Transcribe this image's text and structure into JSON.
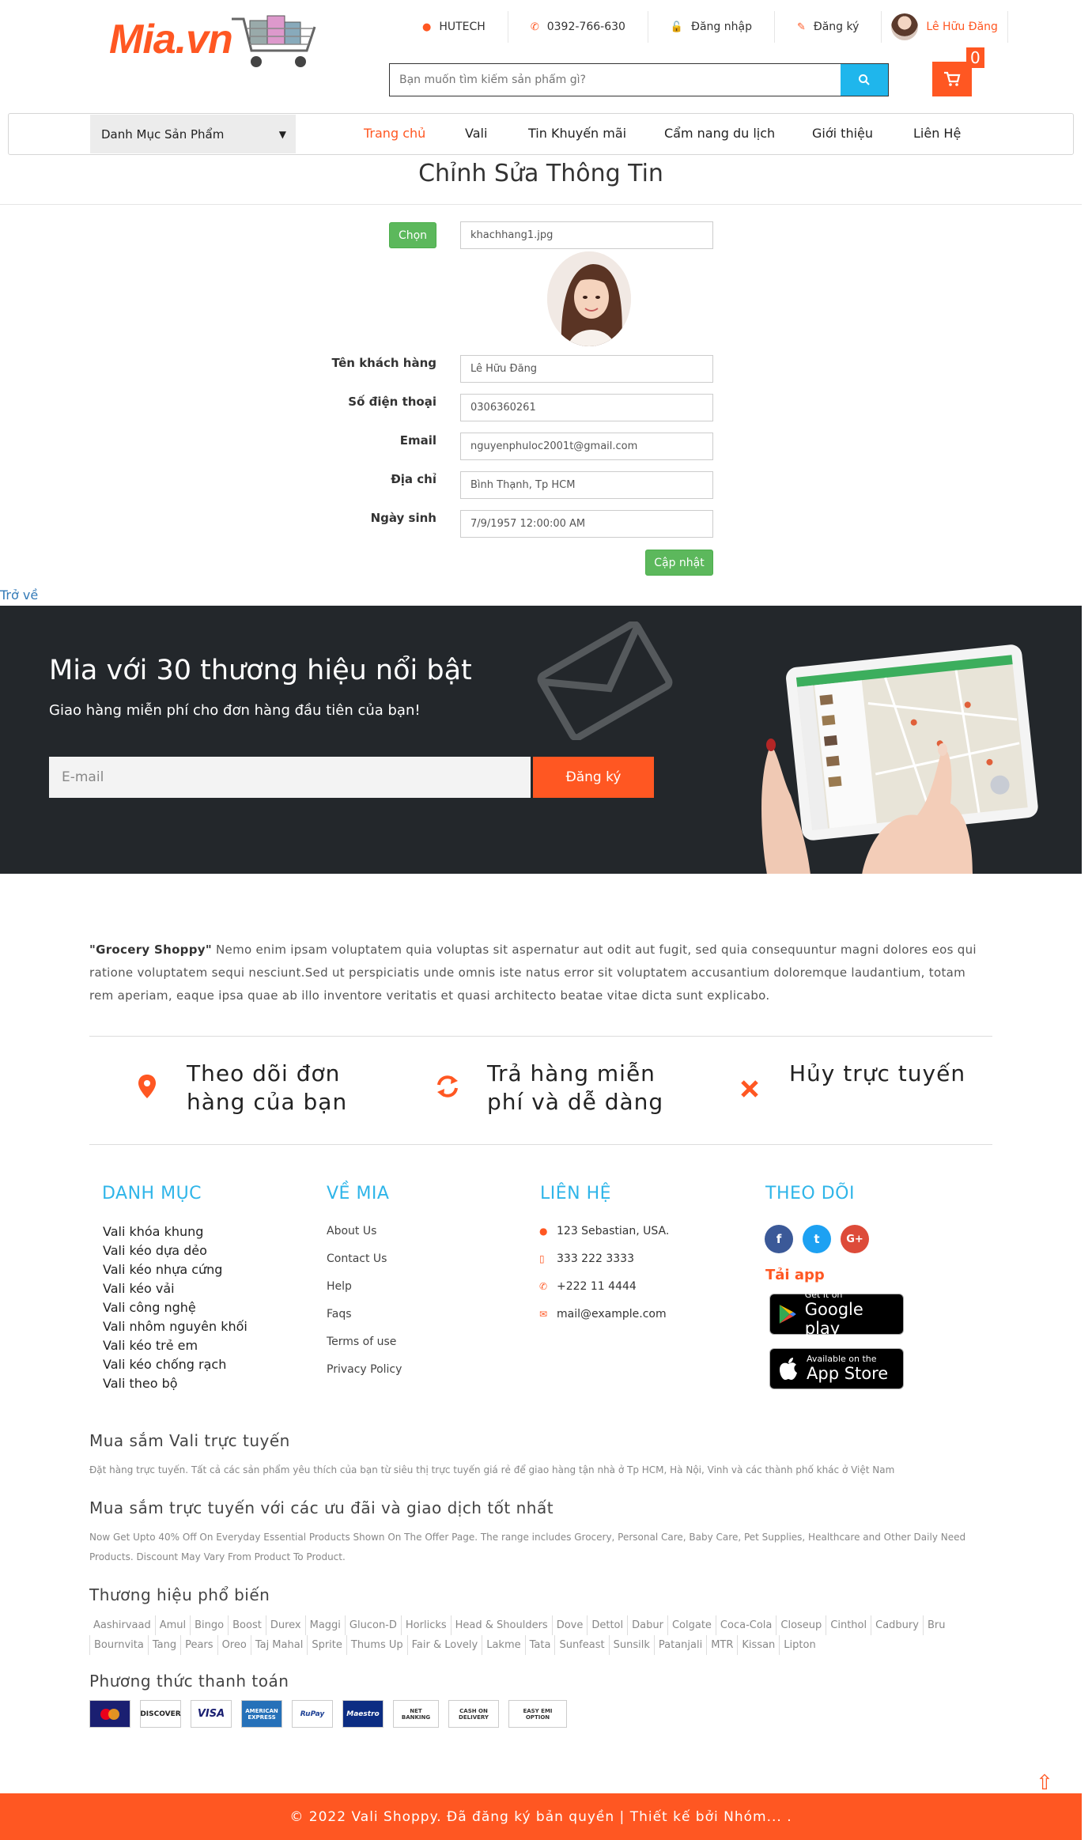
{
  "header": {
    "logo": "Mia.vn",
    "topbar": [
      {
        "icon": "map-marker-icon",
        "label": "HUTECH"
      },
      {
        "icon": "phone-icon",
        "label": "0392-766-630"
      },
      {
        "icon": "unlock-icon",
        "label": "Đăng nhập"
      },
      {
        "icon": "edit-icon",
        "label": "Đăng ký"
      }
    ],
    "user_name": "Lê Hữu Đăng",
    "search_placeholder": "Bạn muốn tìm kiếm sản phẩm gì?",
    "cart_count": "0"
  },
  "nav": {
    "category_select": "Danh Mục Sản Phẩm",
    "links": [
      "Trang chủ",
      "Vali",
      "Tin Khuyến mãi",
      "Cẩm nang du lịch",
      "Giới thiệu",
      "Liên Hệ"
    ]
  },
  "form": {
    "title": "Chỉnh Sửa Thông Tin",
    "choose_label": "Chọn",
    "filename": "khachhang1.jpg",
    "fields": [
      {
        "label": "Tên khách hàng",
        "value": "Lê Hữu Đăng"
      },
      {
        "label": "Số điện thoại",
        "value": "0306360261"
      },
      {
        "label": "Email",
        "value": "nguyenphuloc2001t@gmail.com"
      },
      {
        "label": "Địa chỉ",
        "value": "Bình Thạnh, Tp HCM"
      },
      {
        "label": "Ngày sinh",
        "value": "7/9/1957 12:00:00 AM"
      }
    ],
    "update_label": "Cập nhật",
    "back_label": "Trở về"
  },
  "promo": {
    "heading": "Mia với 30 thương hiệu nổi bật",
    "sub": "Giao hàng miễn phí cho đơn hàng đầu tiên của bạn!",
    "email_placeholder": "E-mail",
    "button": "Đăng ký"
  },
  "about": {
    "brand": "\"Grocery Shoppy\"",
    "text": " Nemo enim ipsam voluptatem quia voluptas sit aspernatur aut odit aut fugit, sed quia consequuntur magni dolores eos qui ratione voluptatem sequi nesciunt.Sed ut perspiciatis unde omnis iste natus error sit voluptatem accusantium doloremque laudantium, totam rem aperiam, eaque ipsa quae ab illo inventore veritatis et quasi architecto beatae vitae dicta sunt explicabo."
  },
  "features": [
    {
      "icon": "map-marker-icon",
      "line1": "Theo dõi đơn",
      "line2": "hàng của bạn"
    },
    {
      "icon": "refresh-icon",
      "line1": "Trả hàng miễn",
      "line2": "phí và dễ dàng"
    },
    {
      "icon": "times-icon",
      "line1": "Hủy trực tuyến",
      "line2": ""
    }
  ],
  "footer": {
    "col1_title": "DANH MỤC",
    "col1": [
      "Vali khóa khung",
      "Vali kéo dựa dẻo",
      "Vali kéo nhựa cứng",
      "Vali kéo vải",
      "Vali công nghệ",
      "Vali nhôm nguyên khối",
      "Vali kéo trẻ em",
      "Vali kéo chống rạch",
      "Vali theo bộ"
    ],
    "col2_title": "VỀ MIA",
    "col2": [
      "About Us",
      "Contact Us",
      "Help",
      "Faqs",
      "Terms of use",
      "Privacy Policy"
    ],
    "col3_title": "LIÊN HỆ",
    "col3": [
      {
        "icon": "map-marker-icon",
        "text": "123 Sebastian, USA."
      },
      {
        "icon": "mobile-icon",
        "text": "333 222 3333"
      },
      {
        "icon": "phone-icon",
        "text": "+222 11 4444"
      },
      {
        "icon": "envelope-icon",
        "text": "mail@example.com"
      }
    ],
    "col4_title": "THEO DÕI",
    "social": [
      {
        "name": "facebook-icon",
        "glyph": "f",
        "color": "#3b5998"
      },
      {
        "name": "twitter-icon",
        "glyph": "t",
        "color": "#1da1f2"
      },
      {
        "name": "google-plus-icon",
        "glyph": "G+",
        "color": "#dd4b39"
      }
    ],
    "app_title": "Tải app",
    "google_small": "Get it on",
    "google_big": "Google play",
    "apple_small": "Available on the",
    "apple_big": "App Store",
    "h1": "Mua sắm Vali trực tuyến",
    "p1": "Đặt hàng trực tuyến. Tất cả các sản phẩm yêu thích của bạn từ siêu thị trực tuyến giá rẻ để giao hàng tận nhà ở Tp HCM, Hà Nội, Vinh và các thành phố khác ở Việt Nam",
    "h2": "Mua sắm trực tuyến với các ưu đãi và giao dịch tốt nhất",
    "p2": "Now Get Upto 40% Off On Everyday Essential Products Shown On The Offer Page. The range includes Grocery, Personal Care, Baby Care, Pet Supplies, Healthcare and Other Daily Need Products. Discount May Vary From Product To Product.",
    "h3": "Thương hiệu phổ biến",
    "brands": [
      "Aashirvaad",
      "Amul",
      "Bingo",
      "Boost",
      "Durex",
      "Maggi",
      "Glucon-D",
      "Horlicks",
      "Head & Shoulders",
      "Dove",
      "Dettol",
      "Dabur",
      "Colgate",
      "Coca-Cola",
      "Closeup",
      "Cinthol",
      "Cadbury",
      "Bru",
      "Bournvita",
      "Tang",
      "Pears",
      "Oreo",
      "Taj Mahal",
      "Sprite",
      "Thums Up",
      "Fair & Lovely",
      "Lakme",
      "Tata",
      "Sunfeast",
      "Sunsilk",
      "Patanjali",
      "MTR",
      "Kissan",
      "Lipton"
    ],
    "h4": "Phương thức thanh toán",
    "payments": [
      "MasterCard",
      "DISCOVER",
      "VISA",
      "AMERICAN EXPRESS",
      "RuPay",
      "Maestro",
      "NET BANKING",
      "CASH ON DELIVERY",
      "EASY EMI OPTION"
    ],
    "copyright": "© 2022 Vali Shoppy. Đã đăng ký bản quyền | Thiết kế bởi Nhóm... ."
  },
  "colors": {
    "accent": "#ff5722",
    "info": "#1fb6ec",
    "success": "#5cb85c",
    "dark": "#23272b",
    "footer_title": "#2fb5e9"
  }
}
